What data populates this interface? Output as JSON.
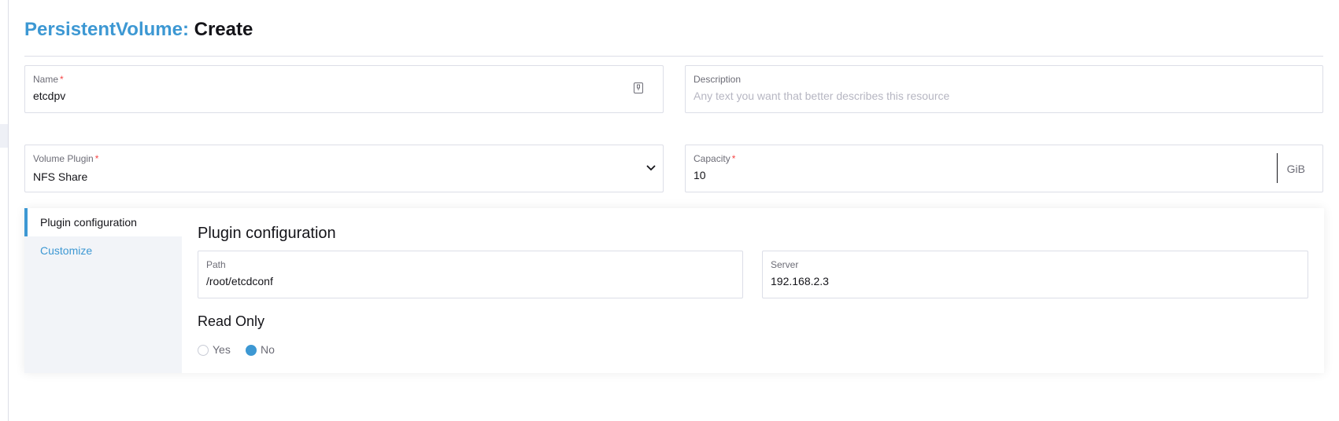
{
  "header": {
    "kind": "PersistentVolume:",
    "action": "Create"
  },
  "name_field": {
    "label": "Name",
    "required": "*",
    "value": "etcdpv",
    "icon": "copy-icon"
  },
  "description_field": {
    "label": "Description",
    "placeholder": "Any text you want that better describes this resource"
  },
  "volume_plugin_field": {
    "label": "Volume Plugin",
    "required": "*",
    "value": "NFS Share",
    "icon": "chevron-down-icon"
  },
  "capacity_field": {
    "label": "Capacity",
    "required": "*",
    "value": "10",
    "unit": "GiB"
  },
  "side_nav": {
    "items": [
      {
        "label": "Plugin configuration",
        "active": true
      },
      {
        "label": "Customize",
        "active": false
      }
    ]
  },
  "plugin_config": {
    "title": "Plugin configuration",
    "path": {
      "label": "Path",
      "value": "/root/etcdconf"
    },
    "server": {
      "label": "Server",
      "value": "192.168.2.3"
    },
    "read_only": {
      "title": "Read Only",
      "options": [
        {
          "label": "Yes",
          "selected": false
        },
        {
          "label": "No",
          "selected": true
        }
      ]
    }
  },
  "colors": {
    "accent": "#3d98d3",
    "required": "#f64747",
    "border": "#dcdee7",
    "nav_background": "#f2f4f8"
  }
}
